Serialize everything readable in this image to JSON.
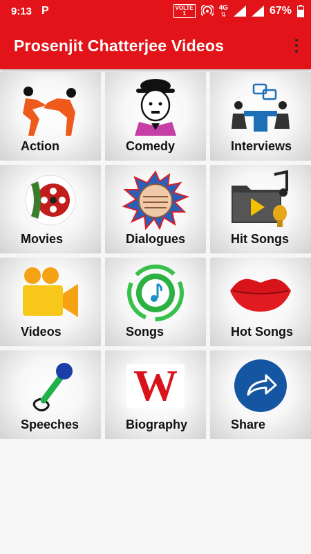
{
  "status": {
    "time": "9:13",
    "app_badge": "P",
    "volte": "VOLTE",
    "volte_sub": "1",
    "network": "4G",
    "battery": "67%"
  },
  "appbar": {
    "title": "Prosenjit Chatterjee Videos"
  },
  "tiles": [
    {
      "label": "Action",
      "icon": "fighting-figures-icon"
    },
    {
      "label": "Comedy",
      "icon": "charlie-chaplin-icon"
    },
    {
      "label": "Interviews",
      "icon": "interview-meeting-icon"
    },
    {
      "label": "Movies",
      "icon": "film-reel-icon"
    },
    {
      "label": "Dialogues",
      "icon": "punching-fist-icon"
    },
    {
      "label": "Hit Songs",
      "icon": "music-folder-icon"
    },
    {
      "label": "Videos",
      "icon": "video-camera-icon"
    },
    {
      "label": "Songs",
      "icon": "music-note-swirl-icon"
    },
    {
      "label": "Hot Songs",
      "icon": "red-lips-icon"
    },
    {
      "label": "Speeches",
      "icon": "microphone-icon"
    },
    {
      "label": "Biography",
      "icon": "wikipedia-w-icon"
    },
    {
      "label": "Share",
      "icon": "share-arrow-icon"
    }
  ],
  "colors": {
    "primary": "#e21419",
    "background": "#f6f6f6"
  }
}
